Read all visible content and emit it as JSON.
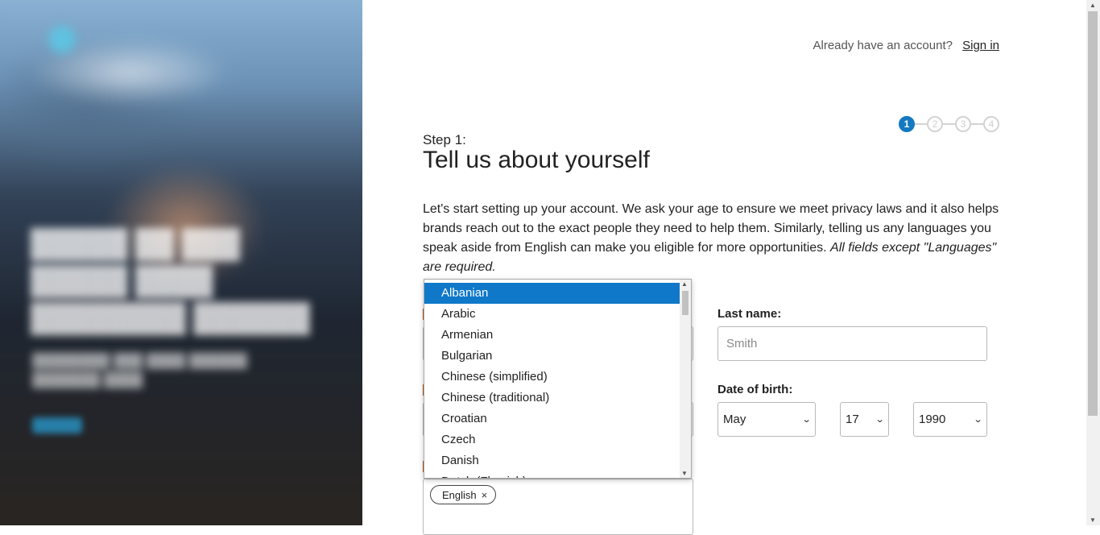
{
  "header": {
    "already_text": "Already have an account?",
    "signin_label": "Sign in"
  },
  "stepper": {
    "steps": [
      "1",
      "2",
      "3",
      "4"
    ],
    "active_step": 1
  },
  "heading": {
    "step_label": "Step 1:",
    "title": "Tell us about yourself"
  },
  "intro": {
    "text": "Let's start setting up your account. We ask your age to ensure we meet privacy laws and it also helps brands reach out to the exact people they need to help them. Similarly, telling us any languages you speak aside from English can make you eligible for more opportunities. ",
    "emphasis": "All fields except \"Languages\" are required."
  },
  "form": {
    "last_name_label": "Last name:",
    "last_name_placeholder": "Smith",
    "dob_label": "Date of birth:",
    "dob_month": "May",
    "dob_day": "17",
    "dob_year": "1990",
    "languages_chips": [
      "English"
    ],
    "chip_remove": "×"
  },
  "dropdown": {
    "items": [
      "Albanian",
      "Arabic",
      "Armenian",
      "Bulgarian",
      "Chinese (simplified)",
      "Chinese (traditional)",
      "Croatian",
      "Czech",
      "Danish",
      "Dutch (Flemish)"
    ],
    "selected": "Albanian"
  },
  "colors": {
    "accent": "#1479c0",
    "selected_bg": "#0f78c8",
    "label_marker": "#c05a1c"
  },
  "icons": {
    "select_chevron": "chevron-down-icon",
    "chip_close": "close-icon"
  }
}
